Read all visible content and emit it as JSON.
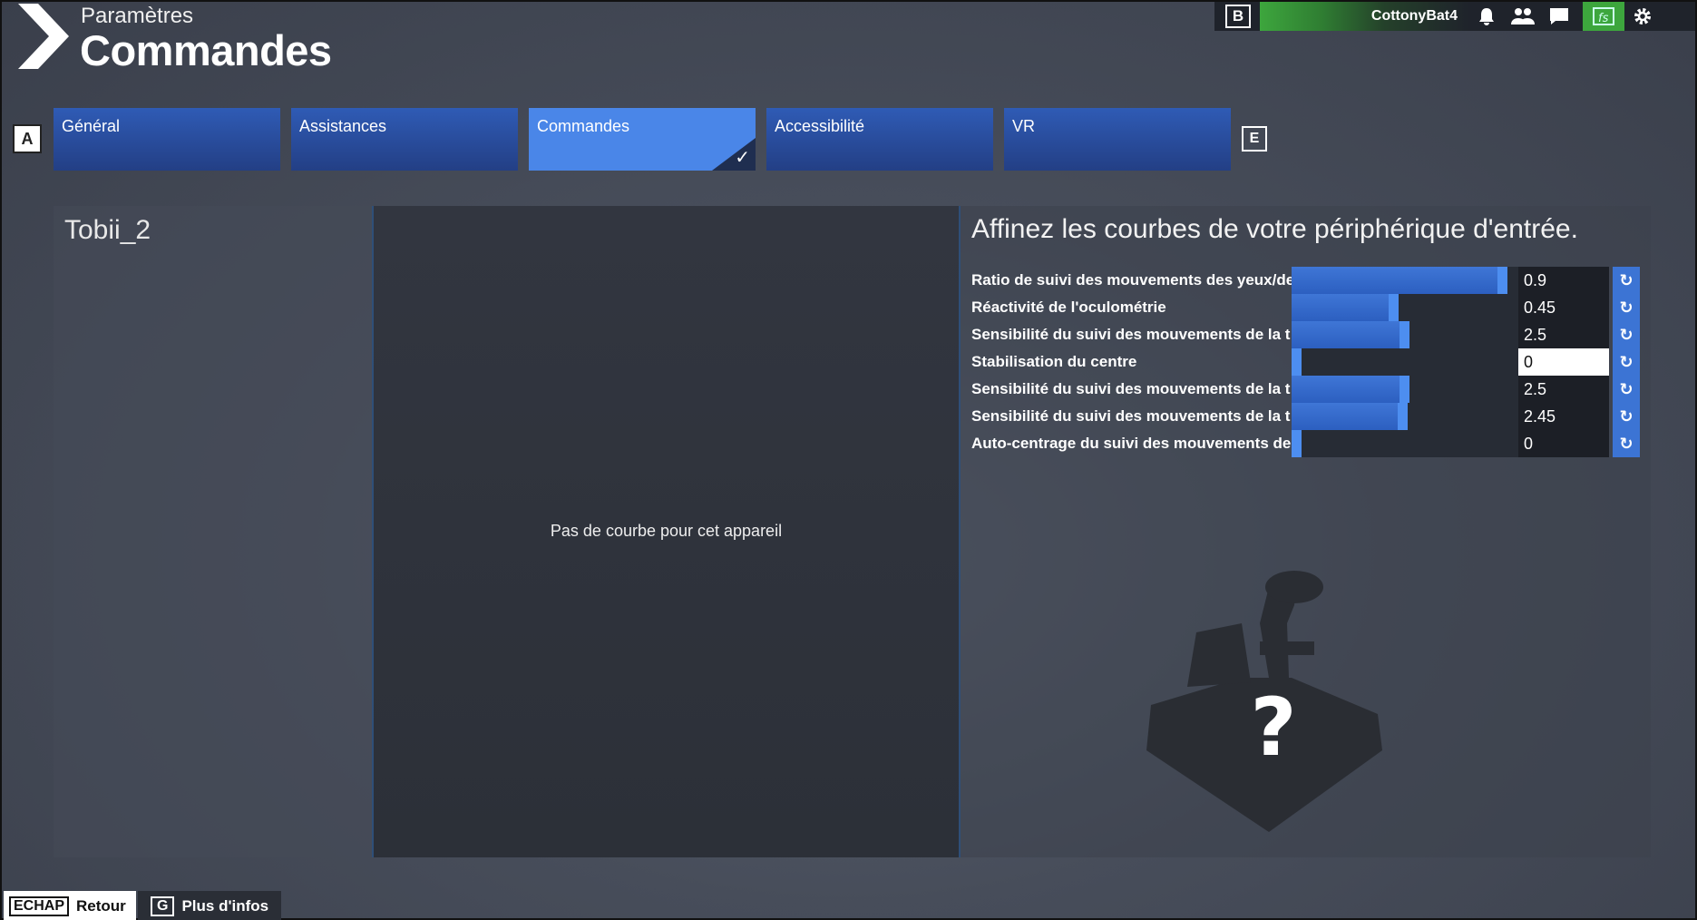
{
  "header": {
    "subtitle": "Paramètres",
    "title": "Commandes"
  },
  "topbar": {
    "key_b": "B",
    "username": "CottonyBat4",
    "icons": [
      "bell-icon",
      "friends-icon",
      "chat-icon",
      "fs-logo-icon",
      "gear-icon"
    ]
  },
  "tabs": {
    "key_left": "A",
    "key_right": "E",
    "items": [
      {
        "label": "Général"
      },
      {
        "label": "Assistances"
      },
      {
        "label": "Commandes",
        "active": true
      },
      {
        "label": "Accessibilité"
      },
      {
        "label": "VR"
      }
    ]
  },
  "left_panel": {
    "device_name": "Tobii_2"
  },
  "middle_panel": {
    "message": "Pas de courbe pour cet appareil"
  },
  "right_panel": {
    "title": "Affinez les courbes de votre périphérique d'entrée.",
    "settings": [
      {
        "label": "Ratio de suivi des mouvements des yeux/de",
        "value": "0.9",
        "fraction": 0.93
      },
      {
        "label": "Réactivité de l'oculométrie",
        "value": "0.45",
        "fraction": 0.45
      },
      {
        "label": "Sensibilité du suivi des mouvements de la t",
        "value": "2.5",
        "fraction": 0.5
      },
      {
        "label": "Stabilisation du centre",
        "value": "0",
        "fraction": 0,
        "focused": true
      },
      {
        "label": "Sensibilité du suivi des mouvements de la t",
        "value": "2.5",
        "fraction": 0.5
      },
      {
        "label": "Sensibilité du suivi des mouvements de la t",
        "value": "2.45",
        "fraction": 0.49
      },
      {
        "label": "Auto-centrage du suivi des mouvements de",
        "value": "0",
        "fraction": 0
      }
    ],
    "unknown_device_glyph": "?"
  },
  "bottom_bar": {
    "back_key": "ECHAP",
    "back_label": "Retour",
    "info_key": "G",
    "info_label": "Plus d'infos"
  },
  "colors": {
    "tab_blue": "#2f5bb5",
    "tab_active": "#4a86e8",
    "slider_fill": "#3f76d6",
    "profile_green": "#3da63d"
  }
}
